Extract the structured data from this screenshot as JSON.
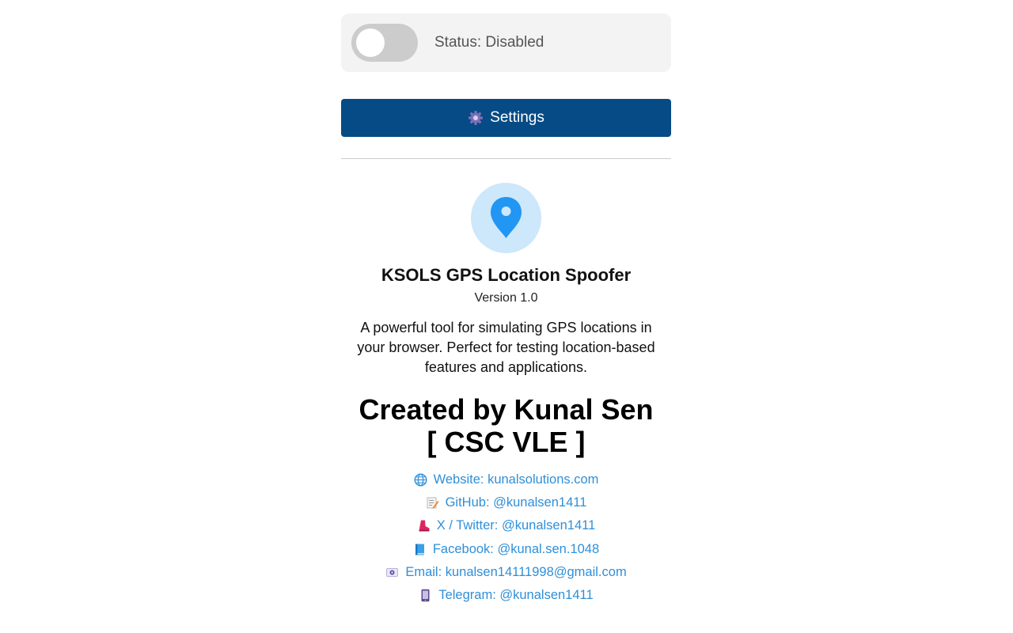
{
  "status": {
    "label": "Status: Disabled",
    "enabled": false
  },
  "settings_button": {
    "label": "Settings",
    "icon": "gear-icon"
  },
  "about": {
    "logo_icon": "map-pin-icon",
    "title": "KSOLS GPS Location Spoofer",
    "version": "Version 1.0",
    "description": "A powerful tool for simulating GPS locations in your browser. Perfect for testing location-based features and applications.",
    "creator_line1": "Created by Kunal Sen",
    "creator_line2": "[ CSC VLE ]"
  },
  "links": [
    {
      "icon": "globe-icon",
      "text": "Website: kunalsolutions.com"
    },
    {
      "icon": "memo-icon",
      "text": "GitHub: @kunalsen1411"
    },
    {
      "icon": "boot-icon",
      "text": "X / Twitter: @kunalsen1411"
    },
    {
      "icon": "book-icon",
      "text": "Facebook: @kunal.sen.1048"
    },
    {
      "icon": "email-icon",
      "text": "Email: kunalsen14111998@gmail.com"
    },
    {
      "icon": "phone-icon",
      "text": "Telegram: @kunalsen1411"
    }
  ],
  "colors": {
    "primary": "#064b86",
    "link": "#2f8fd8",
    "pin": "#2196f3",
    "toggle_off": "#cccccc"
  }
}
